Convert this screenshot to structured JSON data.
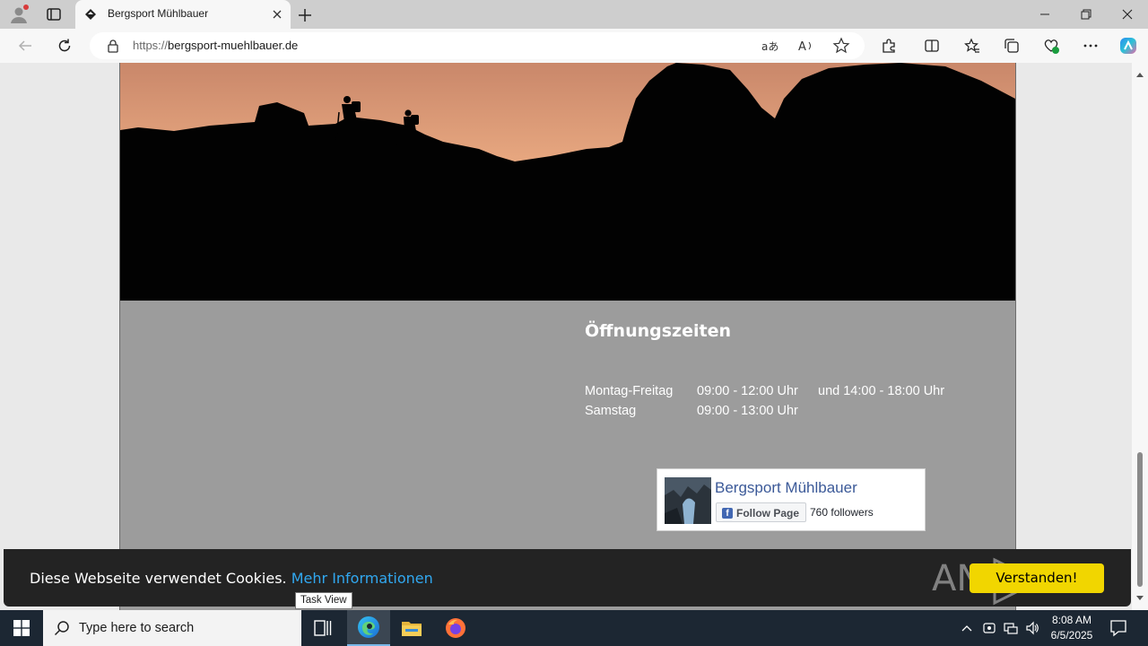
{
  "browser": {
    "tab_title": "Bergsport Mühlbauer",
    "url_protocol": "https://",
    "url_host": "bergsport-muehlbauer.de"
  },
  "page": {
    "hours": {
      "title": "Öffnungszeiten",
      "rows": [
        {
          "day": "Montag-Freitag",
          "time1": "09:00 - 12:00 Uhr",
          "time2": "und 14:00 - 18:00 Uhr"
        },
        {
          "day": "Samstag",
          "time1": "09:00 - 13:00 Uhr",
          "time2": ""
        }
      ]
    },
    "facebook": {
      "page_name": "Bergsport Mühlbauer",
      "follow_label": "Follow Page",
      "fb_glyph": "f",
      "followers": "760 followers"
    },
    "cookie": {
      "text": "Diese Webseite verwendet Cookies.",
      "link": "Mehr Informationen",
      "button": "Verstanden!"
    },
    "watermark": "ANY RUN"
  },
  "tooltip": "Task View",
  "taskbar": {
    "search_placeholder": "Type here to search",
    "time": "8:08 AM",
    "date": "6/5/2025"
  },
  "colors": {
    "cookie_button": "#f1d600",
    "cookie_link": "#31a8f0",
    "gray_band": "#9c9c9c",
    "fb_blue": "#3b5998"
  }
}
